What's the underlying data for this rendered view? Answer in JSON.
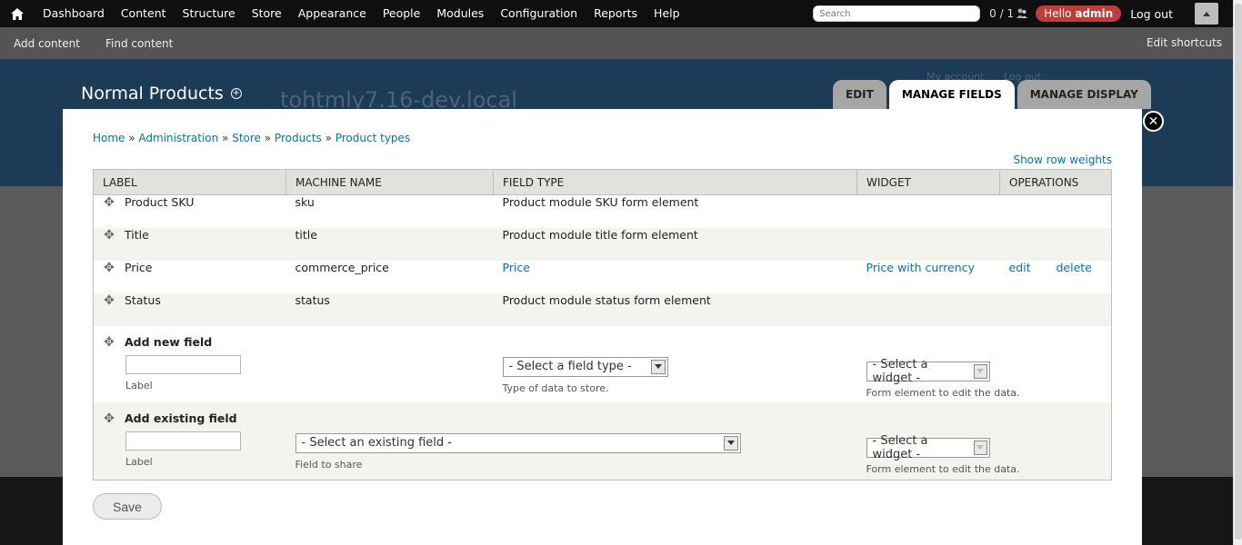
{
  "toolbar": {
    "menu": [
      "Dashboard",
      "Content",
      "Structure",
      "Store",
      "Appearance",
      "People",
      "Modules",
      "Configuration",
      "Reports",
      "Help"
    ],
    "search_placeholder": "Search",
    "counter": "0 / 1",
    "hello": "Hello",
    "username": "admin",
    "logout": "Log out"
  },
  "shortcuts": {
    "items": [
      "Add content",
      "Find content"
    ],
    "edit": "Edit shortcuts"
  },
  "background": {
    "site_name": "tohtmly7.16-dev.local",
    "my_account": "My account",
    "log_out": "Log out"
  },
  "overlay": {
    "title": "Normal Products",
    "tabs": [
      "EDIT",
      "MANAGE FIELDS",
      "MANAGE DISPLAY"
    ],
    "active_tab": "MANAGE FIELDS"
  },
  "breadcrumb": [
    "Home",
    "Administration",
    "Store",
    "Products",
    "Product types"
  ],
  "breadcrumb_sep": " » ",
  "row_weights": "Show row weights",
  "table": {
    "headers": [
      "LABEL",
      "MACHINE NAME",
      "FIELD TYPE",
      "WIDGET",
      "OPERATIONS"
    ],
    "rows": [
      {
        "label": "Product SKU",
        "machine": "sku",
        "type": "Product module SKU form element",
        "widget": "",
        "edit": "",
        "delete": ""
      },
      {
        "label": "Title",
        "machine": "title",
        "type": "Product module title form element",
        "widget": "",
        "edit": "",
        "delete": ""
      },
      {
        "label": "Price",
        "machine": "commerce_price",
        "type": "Price",
        "widget": "Price with currency",
        "edit": "edit",
        "delete": "delete"
      },
      {
        "label": "Status",
        "machine": "status",
        "type": "Product module status form element",
        "widget": "",
        "edit": "",
        "delete": ""
      }
    ],
    "add_new": {
      "title": "Add new field",
      "label_desc": "Label",
      "type_select": "- Select a field type -",
      "type_desc": "Type of data to store.",
      "widget_select": "- Select a widget -",
      "widget_desc": "Form element to edit the data."
    },
    "add_existing": {
      "title": "Add existing field",
      "label_desc": "Label",
      "field_select": "- Select an existing field -",
      "field_desc": "Field to share",
      "widget_select": "- Select a widget -",
      "widget_desc": "Form element to edit the data."
    }
  },
  "save": "Save"
}
